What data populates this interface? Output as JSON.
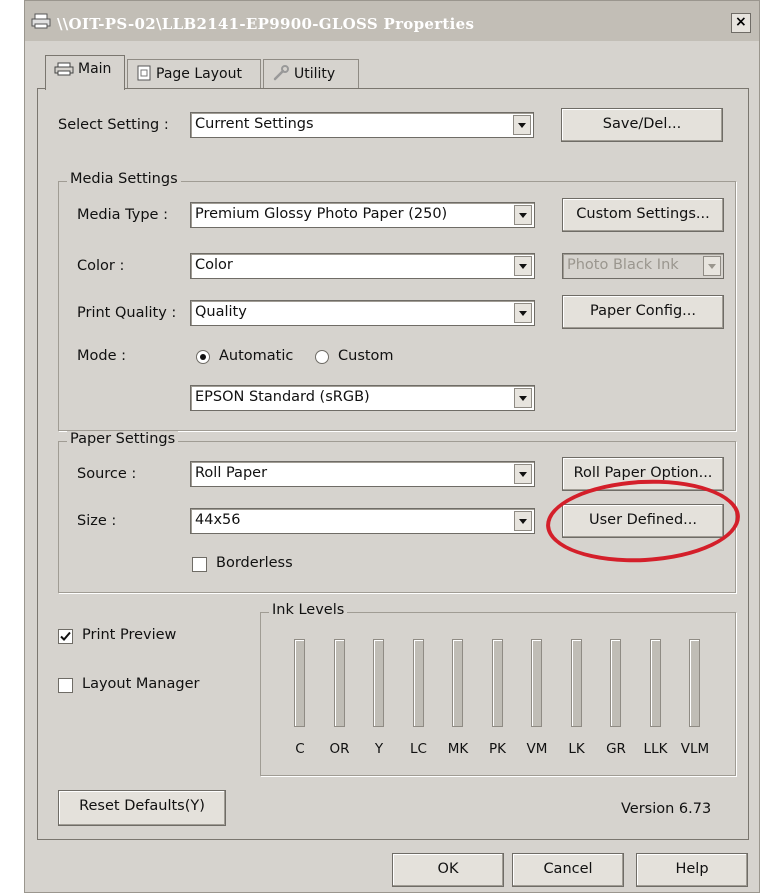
{
  "window": {
    "title": "\\\\OIT-PS-02\\LLB2141-EP9900-GLOSS Properties",
    "close_label": "×"
  },
  "tabs": [
    {
      "label": "Main",
      "icon": "printer-icon",
      "active": true
    },
    {
      "label": "Page Layout",
      "icon": "page-icon"
    },
    {
      "label": "Utility",
      "icon": "wrench-icon"
    }
  ],
  "select_setting": {
    "label": "Select Setting :",
    "value": "Current Settings",
    "button": "Save/Del..."
  },
  "media_settings": {
    "title": "Media Settings",
    "media_type": {
      "label": "Media Type :",
      "value": "Premium Glossy Photo Paper (250)",
      "button": "Custom Settings..."
    },
    "color": {
      "label": "Color :",
      "value": "Color",
      "ink_value": "Photo Black Ink"
    },
    "print_quality": {
      "label": "Print Quality :",
      "value": "Quality",
      "button": "Paper Config..."
    },
    "mode": {
      "label": "Mode :",
      "automatic": "Automatic",
      "custom": "Custom",
      "selected": "Automatic",
      "profile": "EPSON Standard (sRGB)"
    }
  },
  "paper_settings": {
    "title": "Paper Settings",
    "source": {
      "label": "Source :",
      "value": "Roll Paper",
      "button": "Roll Paper Option..."
    },
    "size": {
      "label": "Size :",
      "value": "44x56",
      "button": "User Defined..."
    },
    "borderless": {
      "label": "Borderless",
      "checked": false
    }
  },
  "options": {
    "print_preview": {
      "label": "Print Preview",
      "checked": true
    },
    "layout_manager": {
      "label": "Layout Manager",
      "checked": false
    }
  },
  "ink_levels": {
    "title": "Ink Levels",
    "inks": [
      "C",
      "OR",
      "Y",
      "LC",
      "MK",
      "PK",
      "VM",
      "LK",
      "GR",
      "LLK",
      "VLM"
    ]
  },
  "footer": {
    "reset": "Reset Defaults(Y)",
    "version": "Version 6.73"
  },
  "dialog_buttons": {
    "ok": "OK",
    "cancel": "Cancel",
    "help": "Help"
  },
  "annotation_color": "#d41f2a"
}
